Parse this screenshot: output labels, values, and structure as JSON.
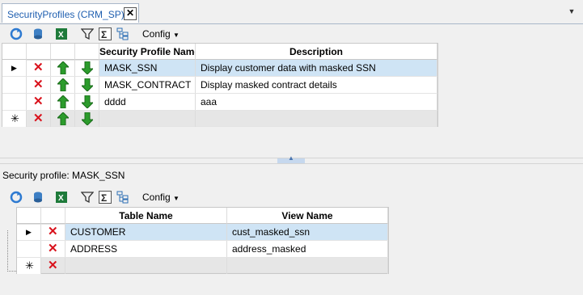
{
  "tab": {
    "label": "SecurityProfiles (CRM_SP)",
    "close": "✕"
  },
  "toolbar_top": {
    "config_label": "Config"
  },
  "grid_top": {
    "headers": [
      "Security Profile Name",
      "Description"
    ],
    "rows": [
      {
        "name": "MASK_SSN",
        "description": "Display customer data with masked SSN"
      },
      {
        "name": "MASK_CONTRACT",
        "description": "Display masked contract details"
      },
      {
        "name": "dddd",
        "description": "aaa"
      }
    ]
  },
  "detail_title": "Security profile: MASK_SSN",
  "toolbar_bottom": {
    "config_label": "Config"
  },
  "grid_bottom": {
    "headers": [
      "Table Name",
      "View Name"
    ],
    "rows": [
      {
        "table": "CUSTOMER",
        "view": "cust_masked_ssn"
      },
      {
        "table": "ADDRESS",
        "view": "address_masked"
      }
    ]
  }
}
